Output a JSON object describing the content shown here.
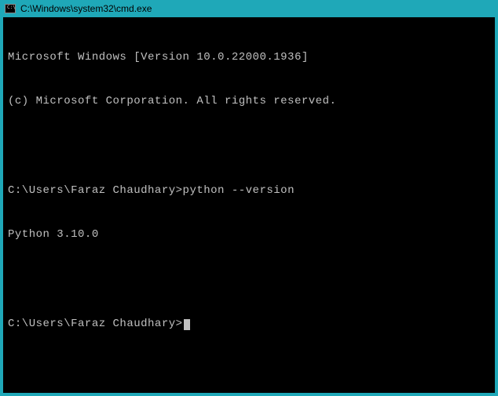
{
  "window": {
    "title": "C:\\Windows\\system32\\cmd.exe",
    "icon_label": "C:\\"
  },
  "terminal": {
    "banner_line1": "Microsoft Windows [Version 10.0.22000.1936]",
    "banner_line2": "(c) Microsoft Corporation. All rights reserved.",
    "prompt1_path": "C:\\Users\\Faraz Chaudhary>",
    "prompt1_command": "python --version",
    "output1": "Python 3.10.0",
    "prompt2_path": "C:\\Users\\Faraz Chaudhary>"
  }
}
